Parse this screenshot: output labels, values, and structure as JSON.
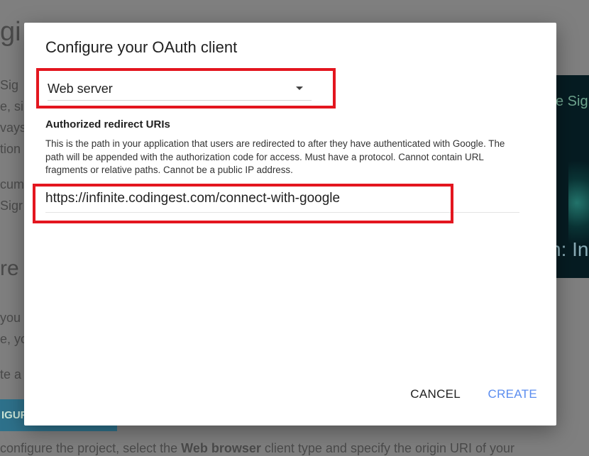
{
  "background": {
    "fragments": [
      "gi",
      "Sig",
      "e, sir",
      "vays",
      "tion",
      "cum",
      "Sigr",
      "re y",
      "you",
      "e, yo",
      "te a"
    ],
    "video_text_top": "e Sig",
    "video_text_bottom": "n: In",
    "button_label": "IGUR",
    "bottom_text_pre": "configure the project, select the ",
    "bottom_text_bold": "Web browser",
    "bottom_text_post": " client type and specify the origin URI of your"
  },
  "dialog": {
    "title": "Configure your OAuth client",
    "client_type": {
      "selected": "Web server"
    },
    "redirect_section": {
      "heading": "Authorized redirect URIs",
      "help": "This is the path in your application that users are redirected to after they have authenticated with Google. The path will be appended with the authorization code for access. Must have a protocol. Cannot contain URL fragments or relative paths. Cannot be a public IP address.",
      "uri_value": "https://infinite.codingest.com/connect-with-google"
    },
    "actions": {
      "cancel": "CANCEL",
      "create": "CREATE"
    }
  },
  "colors": {
    "highlight": "#e3161f",
    "primary_action": "#5b8def",
    "overlay": "#7f7f7f"
  }
}
